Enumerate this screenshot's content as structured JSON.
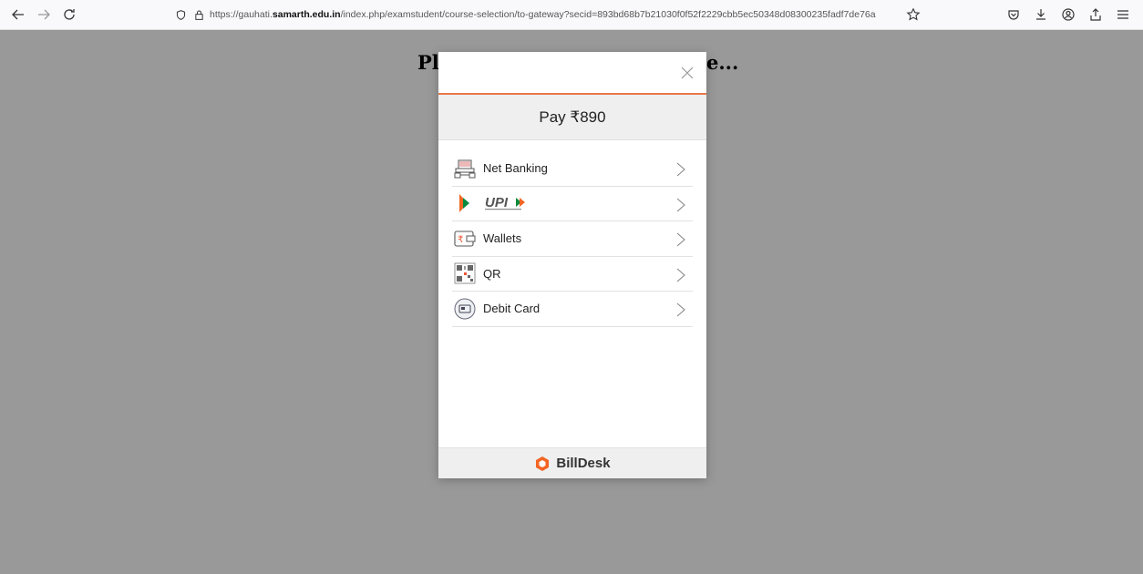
{
  "browser": {
    "url_prefix": "https://gauhati.",
    "url_host": "samarth.edu.in",
    "url_path": "/index.php/examstudent/course-selection/to-gateway?secid=893bd68b7b21030f0f52f2229cbb5ec50348d08300235fadf7de76a"
  },
  "page": {
    "heading_left": "Pl",
    "heading_right": "e..."
  },
  "modal": {
    "pay_label": "Pay ₹890",
    "options": [
      {
        "label": "Net Banking",
        "icon": "bank-icon"
      },
      {
        "label": "",
        "icon": "upi-logo"
      },
      {
        "label": "Wallets",
        "icon": "wallet-icon"
      },
      {
        "label": "QR",
        "icon": "qr-icon"
      },
      {
        "label": "Debit Card",
        "icon": "card-icon"
      }
    ],
    "brand": "BillDesk"
  },
  "colors": {
    "accent": "#e8784a",
    "overlay": "#999999",
    "brand_orange": "#f26522"
  }
}
